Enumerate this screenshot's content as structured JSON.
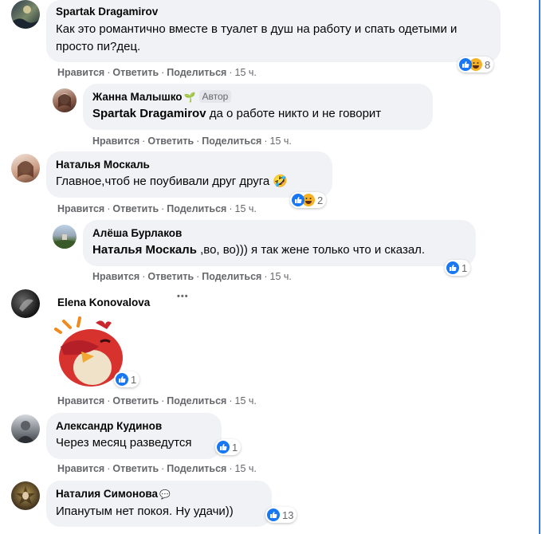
{
  "actions": {
    "like": "Нравится",
    "reply": "Ответить",
    "share": "Поделиться",
    "time": "15 ч.",
    "sep": "·"
  },
  "comments": [
    {
      "author": "Spartak Dragamirov",
      "text": "Как это романтично вместе в туалет в душ на работу и спать одетыми и просто пи?дец.",
      "reactions": [
        "like",
        "haha"
      ],
      "count": "8"
    },
    {
      "author": "Жанна Малышко",
      "badge": "Автор",
      "mention": "Spartak Dragamirov",
      "text": " да о работе никто и не говорит"
    },
    {
      "author": "Наталья Москаль",
      "text": "Главное,чтоб не поубивали друг друга 🤣",
      "reactions": [
        "like",
        "haha"
      ],
      "count": "2"
    },
    {
      "author": "Алёша Бурлаков",
      "mention": "Наталья Москаль",
      "text": " ,во, во))) я так жене только что и сказал.",
      "reactions": [
        "like"
      ],
      "count": "1"
    },
    {
      "author": "Elena Konovalova",
      "menu": "•••",
      "sticker": "red-bird-sticker",
      "reactions": [
        "like"
      ],
      "count": "1"
    },
    {
      "author": "Александр Кудинов",
      "text": "Через месяц разведутся",
      "reactions": [
        "like"
      ],
      "count": "1"
    },
    {
      "author": "Наталия Симонова",
      "text": "Ипанутым нет покоя. Ну удачи))",
      "reactions": [
        "like"
      ],
      "count": "13"
    }
  ],
  "colors": {
    "bubble": "#f0f2f5",
    "like": "#1877f2",
    "meta": "#65676b",
    "accent_line": "#2d7be5"
  }
}
